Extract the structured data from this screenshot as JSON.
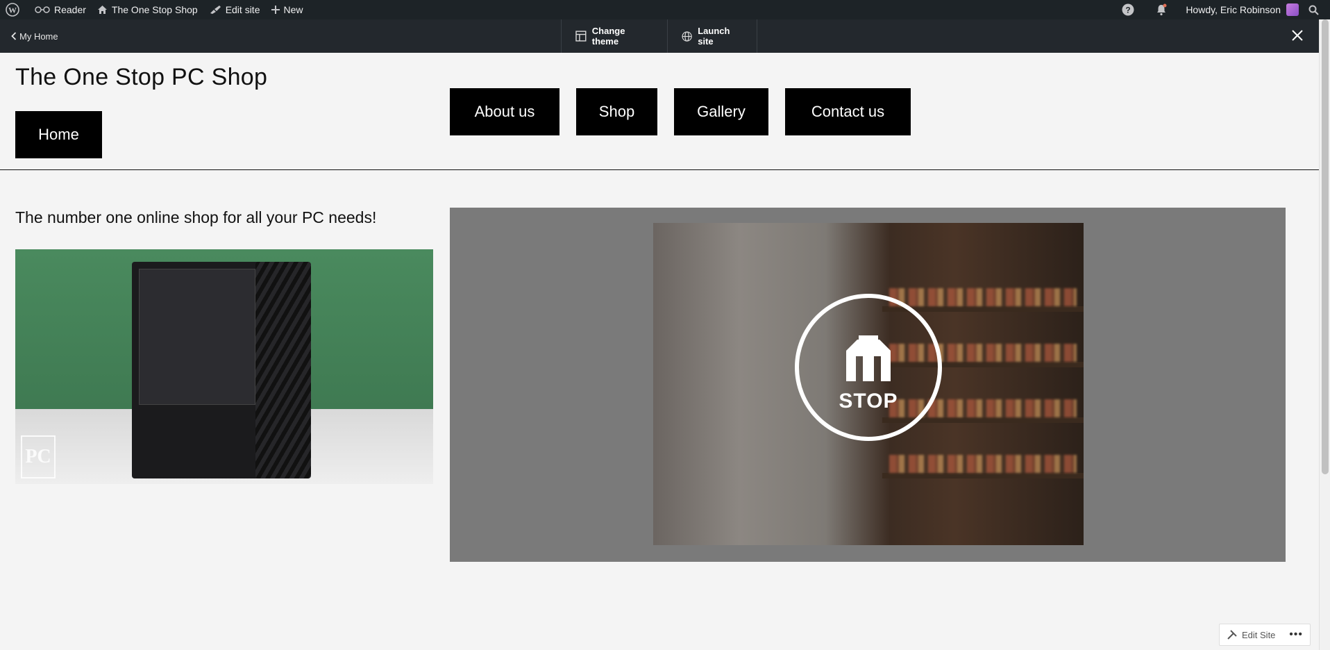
{
  "adminbar": {
    "wp_logo": "wordpress-logo",
    "reader": "Reader",
    "site_name": "The One Stop Shop",
    "edit_site": "Edit site",
    "new": "New",
    "howdy": "Howdy, Eric Robinson"
  },
  "subbar": {
    "my_home": "My Home",
    "change_theme": "Change theme",
    "launch_site": "Launch site"
  },
  "site": {
    "title": "The One Stop PC Shop",
    "nav": [
      "Home",
      "About us",
      "Shop",
      "Gallery",
      "Contact us"
    ],
    "tagline": "The number one online shop for all your PC needs!"
  },
  "images": {
    "pc_logo": "PC",
    "shop_logo": "STOP"
  },
  "floating": {
    "edit_site": "Edit Site",
    "more": "•••"
  },
  "colors": {
    "adminbar_bg": "#1d2327",
    "nav_button_bg": "#000000",
    "cover_bg": "#7a7a7a"
  }
}
